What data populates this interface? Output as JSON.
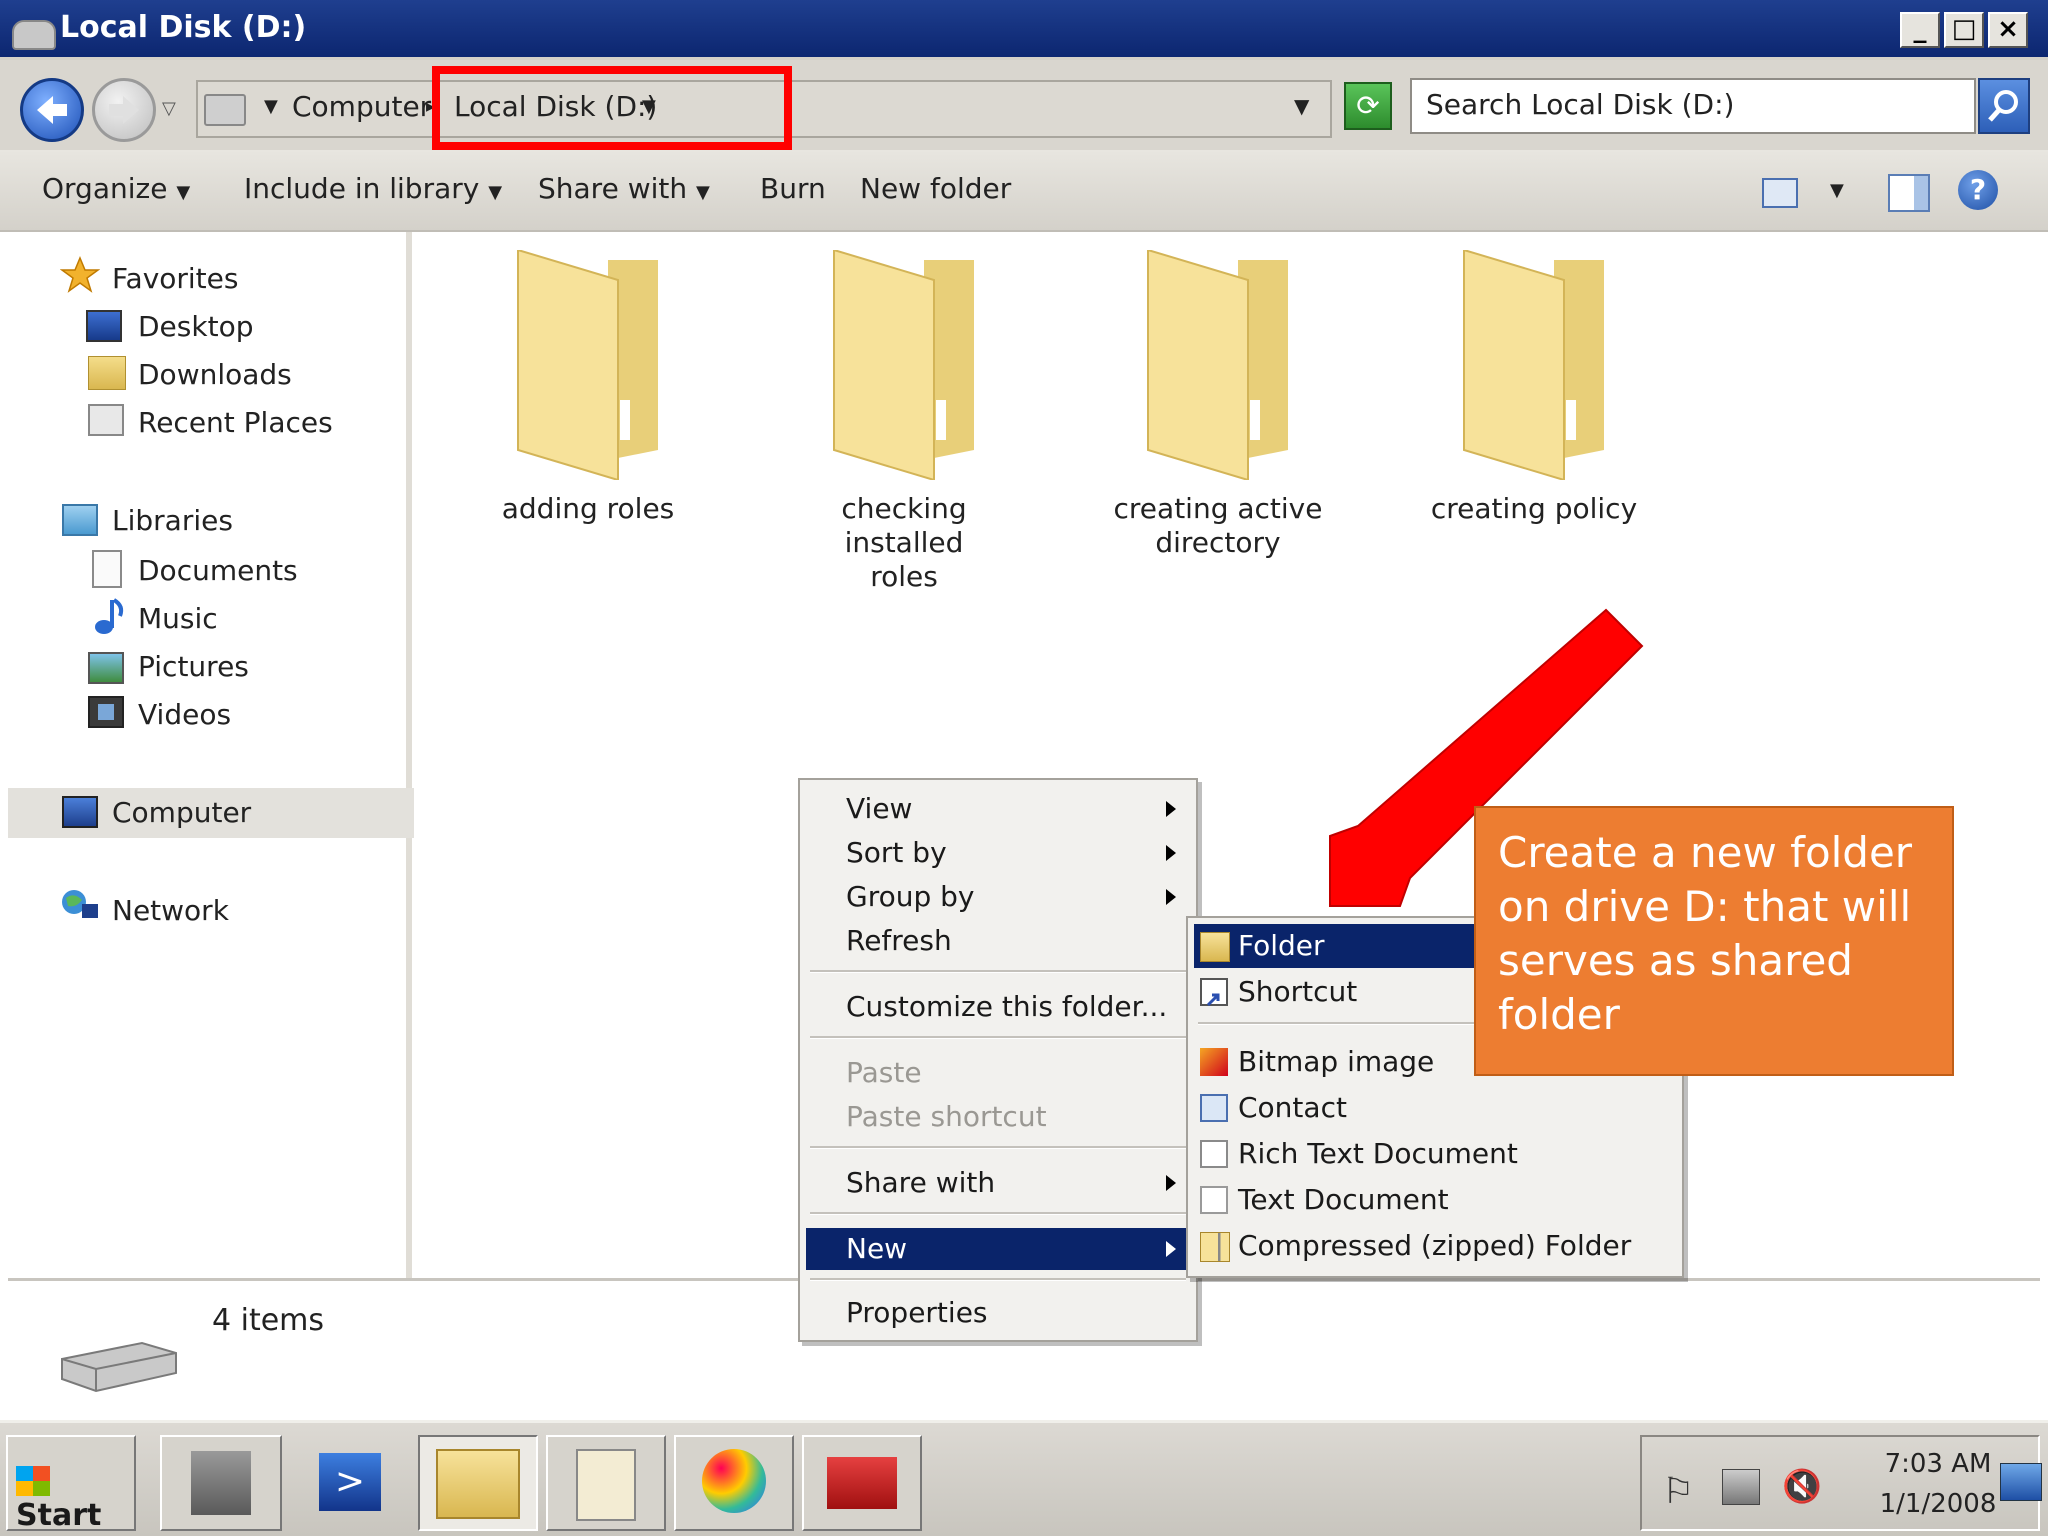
{
  "window": {
    "title": "Local Disk (D:)"
  },
  "address": {
    "crumbs": [
      "Computer",
      "Local Disk (D:)"
    ],
    "search_placeholder": "Search Local Disk (D:)"
  },
  "toolbar": {
    "organize": "Organize",
    "include_in_library": "Include in library",
    "share_with": "Share with",
    "burn": "Burn",
    "new_folder": "New folder"
  },
  "nav": {
    "favorites": "Favorites",
    "favorites_items": [
      "Desktop",
      "Downloads",
      "Recent Places"
    ],
    "libraries": "Libraries",
    "libraries_items": [
      "Documents",
      "Music",
      "Pictures",
      "Videos"
    ],
    "computer": "Computer",
    "network": "Network"
  },
  "folders": [
    {
      "line1": "adding roles",
      "line2": ""
    },
    {
      "line1": "checking installed",
      "line2": "roles"
    },
    {
      "line1": "creating active",
      "line2": "directory"
    },
    {
      "line1": "creating policy",
      "line2": ""
    }
  ],
  "status": {
    "items": "4 items"
  },
  "context_menu": {
    "view": "View",
    "sort_by": "Sort by",
    "group_by": "Group by",
    "refresh": "Refresh",
    "customize": "Customize this folder...",
    "paste": "Paste",
    "paste_shortcut": "Paste shortcut",
    "share_with": "Share with",
    "new": "New",
    "properties": "Properties"
  },
  "new_submenu": {
    "folder": "Folder",
    "shortcut": "Shortcut",
    "bitmap": "Bitmap image",
    "contact": "Contact",
    "rtf": "Rich Text Document",
    "txt": "Text Document",
    "zip": "Compressed (zipped) Folder"
  },
  "callout": {
    "text": "Create a new folder on drive D: that will serves as shared folder"
  },
  "taskbar": {
    "start": "Start",
    "time": "7:03 AM",
    "date": "1/1/2008"
  },
  "colors": {
    "highlight": "#0a246a",
    "callout": "#ed7d31",
    "annotation": "#ff0000",
    "title_bar": "#1f3f8f"
  }
}
